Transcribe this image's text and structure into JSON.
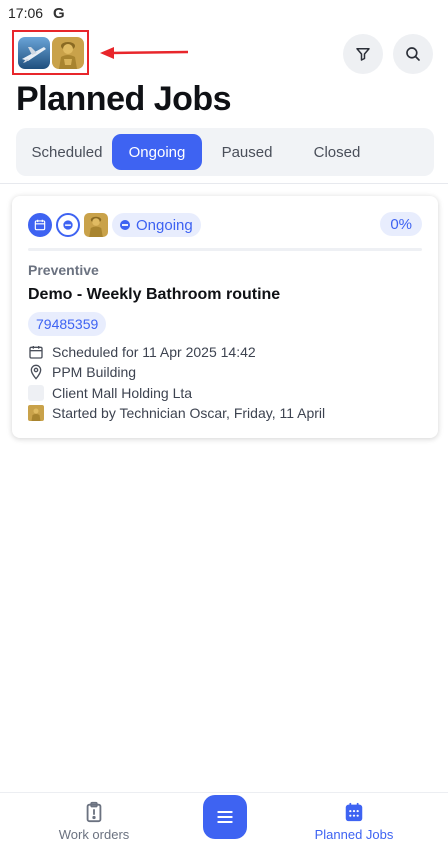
{
  "status_bar": {
    "time": "17:06",
    "g_label": "G"
  },
  "header": {
    "avatars": [
      "airplane-avatar",
      "statue-avatar"
    ],
    "filter_icon": "filter-icon",
    "search_icon": "search-icon",
    "annotation_color": "#e8262b"
  },
  "page": {
    "title": "Planned Jobs"
  },
  "tabs": [
    {
      "label": "Scheduled",
      "active": false
    },
    {
      "label": "Ongoing",
      "active": true
    },
    {
      "label": "Paused",
      "active": false
    },
    {
      "label": "Closed",
      "active": false
    }
  ],
  "job": {
    "status": "Ongoing",
    "progress": "0%",
    "category": "Preventive",
    "title": "Demo - Weekly Bathroom routine",
    "id": "79485359",
    "scheduled": "Scheduled for 11 Apr 2025 14:42",
    "location": "PPM Building",
    "client": "Client Mall Holding Lta",
    "started_by": "Started by Technician Oscar, Friday, 11 April"
  },
  "bottom_nav": {
    "work_orders": "Work orders",
    "planned_jobs": "Planned Jobs"
  },
  "colors": {
    "accent": "#3e63f2",
    "accent_light": "#e8edfd"
  }
}
